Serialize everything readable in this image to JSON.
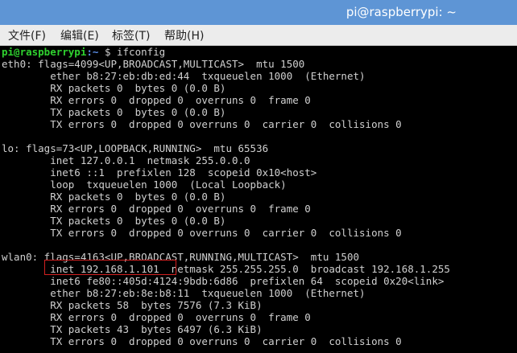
{
  "window": {
    "title": "pi@raspberrypi: ~"
  },
  "menu": [
    {
      "label": "文件(F)"
    },
    {
      "label": "编辑(E)"
    },
    {
      "label": "标签(T)"
    },
    {
      "label": "帮助(H)"
    }
  ],
  "prompt": {
    "user_host": "pi@raspberrypi",
    "path": ":~",
    "symbol": " $ ",
    "command": "ifconfig"
  },
  "lines": [
    "eth0: flags=4099<UP,BROADCAST,MULTICAST>  mtu 1500",
    "        ether b8:27:eb:db:ed:44  txqueuelen 1000  (Ethernet)",
    "        RX packets 0  bytes 0 (0.0 B)",
    "        RX errors 0  dropped 0  overruns 0  frame 0",
    "        TX packets 0  bytes 0 (0.0 B)",
    "        TX errors 0  dropped 0 overruns 0  carrier 0  collisions 0",
    "",
    "lo: flags=73<UP,LOOPBACK,RUNNING>  mtu 65536",
    "        inet 127.0.0.1  netmask 255.0.0.0",
    "        inet6 ::1  prefixlen 128  scopeid 0x10<host>",
    "        loop  txqueuelen 1000  (Local Loopback)",
    "        RX packets 0  bytes 0 (0.0 B)",
    "        RX errors 0  dropped 0  overruns 0  frame 0",
    "        TX packets 0  bytes 0 (0.0 B)",
    "        TX errors 0  dropped 0 overruns 0  carrier 0  collisions 0",
    "",
    "wlan0: flags=4163<UP,BROADCAST,RUNNING,MULTICAST>  mtu 1500",
    "        inet 192.168.1.101  netmask 255.255.255.0  broadcast 192.168.1.255",
    "        inet6 fe80::405d:4124:9bdb:6d86  prefixlen 64  scopeid 0x20<link>",
    "        ether b8:27:eb:8e:b8:11  txqueuelen 1000  (Ethernet)",
    "        RX packets 58  bytes 7576 (7.3 KiB)",
    "        RX errors 0  dropped 0  overruns 0  frame 0",
    "        TX packets 43  bytes 6497 (6.3 KiB)",
    "        TX errors 0  dropped 0 overruns 0  carrier 0  collisions 0"
  ],
  "colors": {
    "titlebar": "#5e95d5",
    "prompt_user": "#2fd12f",
    "prompt_path": "#5b8ee8",
    "terminal_text": "#d0d0d0",
    "highlight": "#d22020"
  }
}
